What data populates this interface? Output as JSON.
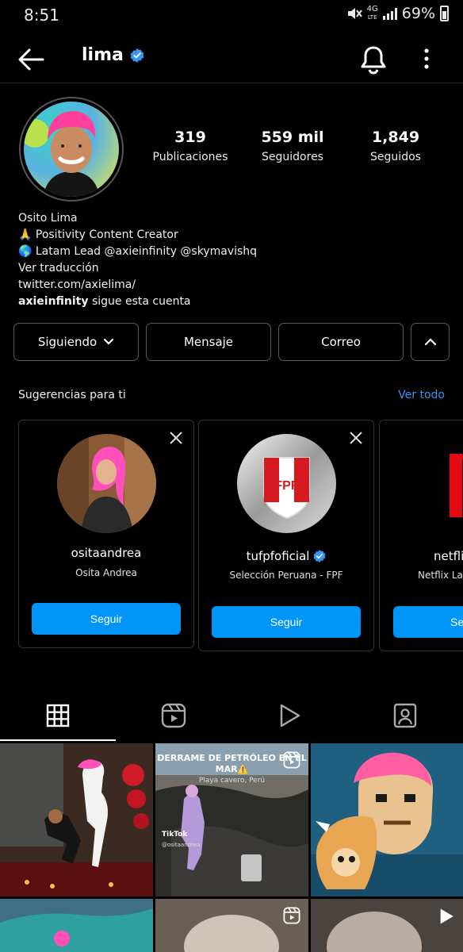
{
  "status_bar": {
    "time": "8:51",
    "network": "4G",
    "network_sub": "LTE",
    "battery": "69%"
  },
  "topbar": {
    "username": "lima",
    "icons": [
      "back-arrow-icon",
      "verified-badge-icon",
      "bell-icon",
      "more-vertical-icon"
    ]
  },
  "profile": {
    "stats": [
      {
        "value": "319",
        "label": "Publicaciones"
      },
      {
        "value": "559 mil",
        "label": "Seguidores"
      },
      {
        "value": "1,849",
        "label": "Seguidos"
      }
    ],
    "bio": {
      "name": "Osito Lima",
      "line1": "🙏 Positivity Content Creator",
      "line2": "🌎 Latam Lead @axieinfinity @skymavishq",
      "translate": "Ver traducción",
      "link": "twitter.com/axielima/",
      "followed_by_user": "axieinfinity",
      "followed_by_text": " sigue esta cuenta"
    }
  },
  "actions": {
    "following": "Siguiendo",
    "message": "Mensaje",
    "email": "Correo"
  },
  "suggestions": {
    "title": "Sugerencias para ti",
    "see_all": "Ver todo",
    "cards": [
      {
        "username": "ositaandrea",
        "subtitle": "Osita Andrea",
        "button": "Seguir",
        "verified": false
      },
      {
        "username": "tufpfoficial",
        "subtitle": "Selección Peruana - FPF",
        "button": "Seguir",
        "verified": true
      },
      {
        "username": "netfli",
        "subtitle": "Netflix La",
        "button": "Se",
        "verified": false
      }
    ]
  },
  "tabs": [
    "grid-icon",
    "reels-icon",
    "play-icon",
    "tagged-icon"
  ],
  "grid": {
    "tile2_title": "DERRAME DE PETRÓLEO EN EL MAR⚠️",
    "tile2_sub": "Playa cavero, Perú",
    "tile2_tiktok": "TikTok",
    "tile2_handle": "@ositaandrea",
    "fpf_text": "FPF"
  },
  "colors": {
    "accent": "#0095f6",
    "link": "#3797f0",
    "background": "#000000"
  }
}
